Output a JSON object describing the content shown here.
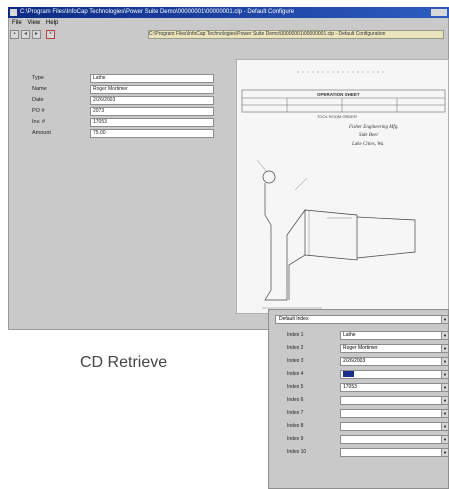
{
  "window": {
    "title": "C:\\Program Files\\InfoCap Technologies\\Power Suite Demo\\00000001\\00000001.clp - Default Configure",
    "menu": [
      "File",
      "View",
      "Help"
    ],
    "path_tab": "C:\\Program Files\\InfoCap Technologies\\Power Suite Demo\\00000001\\00000001.clp - Default Configuration"
  },
  "fields": [
    {
      "label": "Type",
      "value": "Lathe"
    },
    {
      "label": "Name",
      "value": "Roger Mortimer"
    },
    {
      "label": "Date",
      "value": "2/26/2003"
    },
    {
      "label": "PO #",
      "value": "2073"
    },
    {
      "label": "Inv. #",
      "value": "17053"
    },
    {
      "label": "Amount",
      "value": "75.00"
    }
  ],
  "document": {
    "heading": "OPERATION SHEET",
    "subheading": "TOOL ROOM ORDER",
    "handwritten": [
      "Fisher Engineering Mfg.",
      "Side Beer",
      "Lake Cities, Wa."
    ]
  },
  "caption": "CD Retrieve",
  "index_panel": {
    "select_label": "Default Index",
    "rows": [
      {
        "label": "Index 1",
        "value": "Lathe"
      },
      {
        "label": "Index 2",
        "value": "Roger Mortimer"
      },
      {
        "label": "Index 3",
        "value": "2/26/2003"
      },
      {
        "label": "Index 4",
        "value": "2073"
      },
      {
        "label": "Index 5",
        "value": "17053"
      },
      {
        "label": "Index 6",
        "value": ""
      },
      {
        "label": "Index 7",
        "value": ""
      },
      {
        "label": "Index 8",
        "value": ""
      },
      {
        "label": "Index 9",
        "value": ""
      },
      {
        "label": "Index 10",
        "value": ""
      }
    ]
  },
  "colors": {
    "titlebar": "#0b2a83",
    "window_bg": "#c9c9c9",
    "highlight": "#1b2f8c"
  }
}
